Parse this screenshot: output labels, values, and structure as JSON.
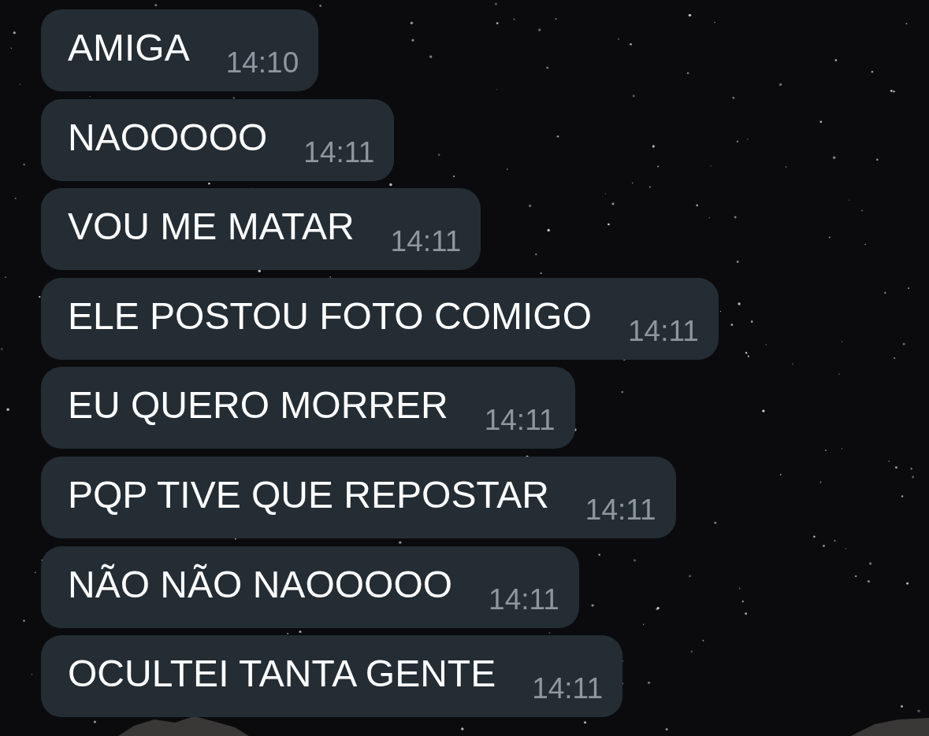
{
  "messages": [
    {
      "text": "AMIGA",
      "time": "14:10"
    },
    {
      "text": "NAOOOOO",
      "time": "14:11"
    },
    {
      "text": "VOU ME MATAR",
      "time": "14:11"
    },
    {
      "text": "ELE POSTOU FOTO COMIGO",
      "time": "14:11"
    },
    {
      "text": "EU QUERO MORRER",
      "time": "14:11"
    },
    {
      "text": "PQP TIVE QUE REPOSTAR",
      "time": "14:11"
    },
    {
      "text": "NÃO NÃO NAOOOOO",
      "time": "14:11"
    },
    {
      "text": "OCULTEI TANTA GENTE",
      "time": "14:11"
    }
  ]
}
